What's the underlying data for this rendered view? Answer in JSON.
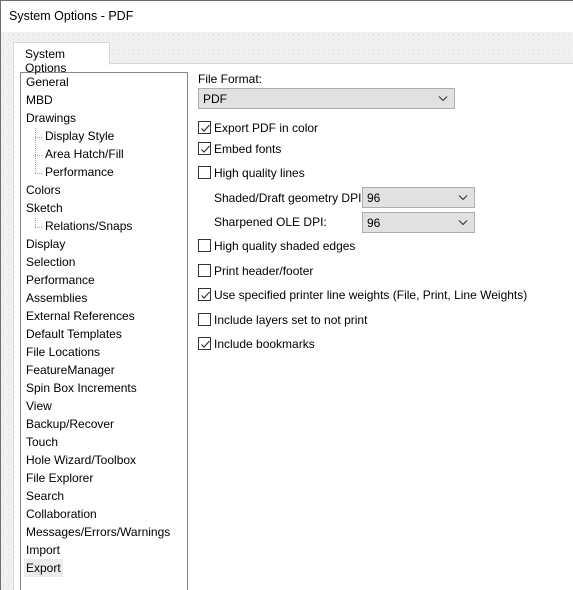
{
  "window": {
    "title": "System Options - PDF"
  },
  "tabs": [
    {
      "label": "System Options",
      "active": true
    }
  ],
  "tree": {
    "items": [
      {
        "label": "General",
        "level": 0
      },
      {
        "label": "MBD",
        "level": 0
      },
      {
        "label": "Drawings",
        "level": 0
      },
      {
        "label": "Display Style",
        "level": 1
      },
      {
        "label": "Area Hatch/Fill",
        "level": 1
      },
      {
        "label": "Performance",
        "level": 1
      },
      {
        "label": "Colors",
        "level": 0
      },
      {
        "label": "Sketch",
        "level": 0
      },
      {
        "label": "Relations/Snaps",
        "level": 1
      },
      {
        "label": "Display",
        "level": 0
      },
      {
        "label": "Selection",
        "level": 0
      },
      {
        "label": "Performance",
        "level": 0
      },
      {
        "label": "Assemblies",
        "level": 0
      },
      {
        "label": "External References",
        "level": 0
      },
      {
        "label": "Default Templates",
        "level": 0
      },
      {
        "label": "File Locations",
        "level": 0
      },
      {
        "label": "FeatureManager",
        "level": 0
      },
      {
        "label": "Spin Box Increments",
        "level": 0
      },
      {
        "label": "View",
        "level": 0
      },
      {
        "label": "Backup/Recover",
        "level": 0
      },
      {
        "label": "Touch",
        "level": 0
      },
      {
        "label": "Hole Wizard/Toolbox",
        "level": 0
      },
      {
        "label": "File Explorer",
        "level": 0
      },
      {
        "label": "Search",
        "level": 0
      },
      {
        "label": "Collaboration",
        "level": 0
      },
      {
        "label": "Messages/Errors/Warnings",
        "level": 0
      },
      {
        "label": "Import",
        "level": 0
      },
      {
        "label": "Export",
        "level": 0,
        "selected": true
      }
    ]
  },
  "panel": {
    "file_format_label": "File Format:",
    "file_format_value": "PDF",
    "options": {
      "export_color": {
        "label": "Export PDF in color",
        "checked": true
      },
      "embed_fonts": {
        "label": "Embed fonts",
        "checked": true
      },
      "high_quality_lines": {
        "label": "High quality lines",
        "checked": false
      },
      "high_quality_shaded_edges": {
        "label": "High quality shaded edges",
        "checked": false
      },
      "print_header_footer": {
        "label": "Print header/footer",
        "checked": false
      },
      "printer_line_weights": {
        "label": "Use specified printer line weights (File, Print, Line Weights)",
        "checked": true
      },
      "include_layers": {
        "label": "Include layers set to not print",
        "checked": false
      },
      "include_bookmarks": {
        "label": "Include bookmarks",
        "checked": true
      }
    },
    "shaded_dpi_label": "Shaded/Draft geometry DPI:",
    "shaded_dpi_value": "96",
    "ole_dpi_label": "Sharpened OLE DPI:",
    "ole_dpi_value": "96"
  },
  "icons": {
    "checkmark": "check-icon",
    "dropdown": "chevron-down-icon"
  }
}
